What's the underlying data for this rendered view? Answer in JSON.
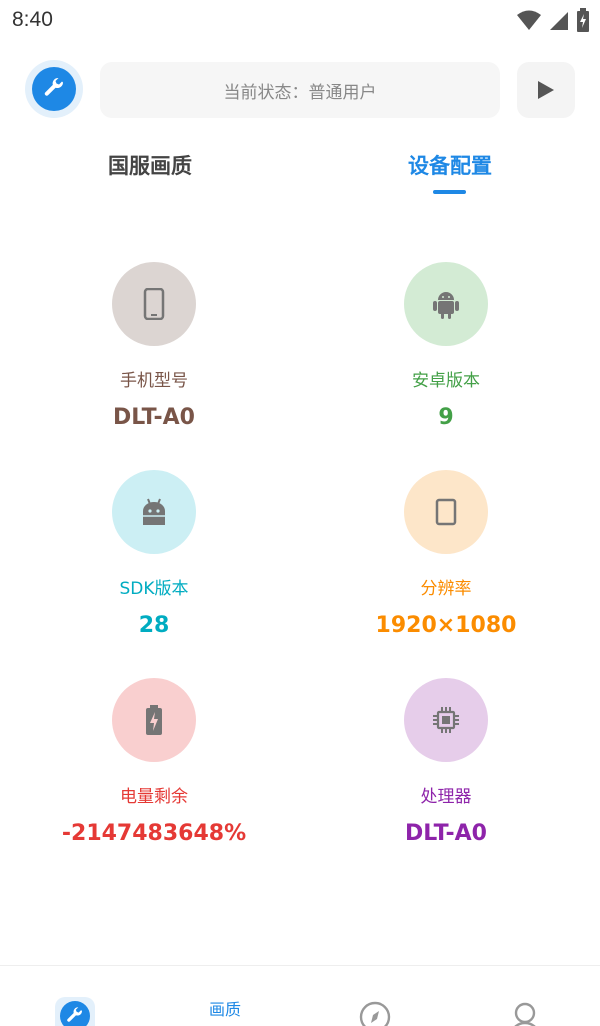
{
  "status_bar": {
    "time": "8:40"
  },
  "header": {
    "status_text": "当前状态：普通用户"
  },
  "tabs": [
    {
      "label": "国服画质",
      "active": false
    },
    {
      "label": "设备配置",
      "active": true
    }
  ],
  "device_info": [
    {
      "label": "手机型号",
      "value": "DLT-A0",
      "icon": "phone-icon",
      "color": "#795548",
      "bg": "#dcd5d2"
    },
    {
      "label": "安卓版本",
      "value": "9",
      "icon": "android-icon",
      "color": "#43a047",
      "bg": "#d3ebd4"
    },
    {
      "label": "SDK版本",
      "value": "28",
      "icon": "robot-icon",
      "color": "#00acc1",
      "bg": "#cceff4"
    },
    {
      "label": "分辨率",
      "value": "1920×1080",
      "icon": "tablet-icon",
      "color": "#fb8c00",
      "bg": "#fde6c9"
    },
    {
      "label": "电量剩余",
      "value": "-2147483648%",
      "icon": "battery-icon",
      "color": "#e53935",
      "bg": "#f9cfcf"
    },
    {
      "label": "处理器",
      "value": "DLT-A0",
      "icon": "chip-icon",
      "color": "#8e24aa",
      "bg": "#e6cdea"
    }
  ],
  "bottom_nav": {
    "items": [
      {
        "label": "画质",
        "icon": "wrench-icon",
        "active": true
      },
      {
        "label": "",
        "icon": "compass-icon",
        "active": false
      },
      {
        "label": "",
        "icon": "user-icon",
        "active": false
      }
    ]
  },
  "colors": {
    "accent": "#1e88e5"
  }
}
